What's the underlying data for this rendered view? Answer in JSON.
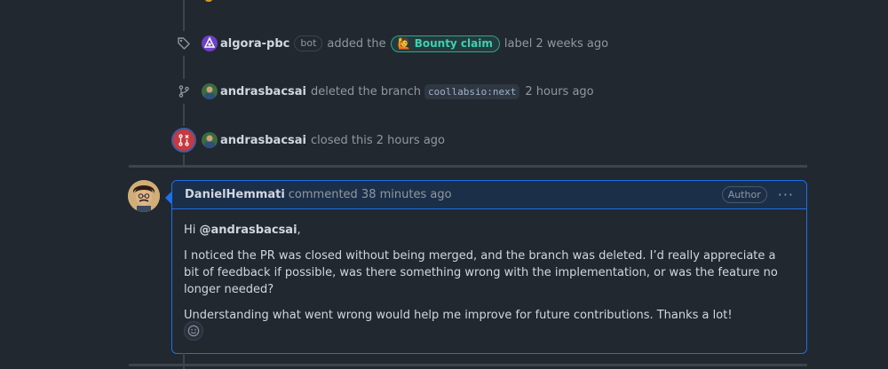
{
  "timeline": {
    "events": [
      {
        "actor": "algora-pbc",
        "bot_tag": "bot",
        "action": "added the",
        "label": "🙋 Bounty claim",
        "trailing": "label",
        "time": "2 weeks ago"
      },
      {
        "actor": "andrasbacsai",
        "action": "deleted the branch",
        "branch": "coollabsio:next",
        "time": "2 hours ago"
      },
      {
        "actor": "andrasbacsai",
        "action": "closed this",
        "time": "2 hours ago"
      }
    ]
  },
  "comment": {
    "author": "DanielHemmati",
    "meta": "commented 38 minutes ago",
    "badge": "Author",
    "menu": "···",
    "greeting_prefix": "Hi ",
    "mention": "@andrasbacsai",
    "greeting_suffix": ",",
    "paragraph1": "I noticed the PR was closed without being merged, and the branch was deleted. I’d really appreciate a bit of feedback if possible, was there something wrong with the implementation, or was the feature no longer needed?",
    "paragraph2": "Understanding what went wrong would help me improve for future contributions. Thanks a lot!"
  },
  "colors": {
    "background": "#212830",
    "comment_border": "#1f6feb",
    "comment_header": "#1c2f48",
    "closed_badge": "#c63a3f",
    "label_teal": "#3fd0b1"
  },
  "icons": [
    "tag-icon",
    "git-branch-icon",
    "pr-closed-icon",
    "smiley-icon",
    "kebab-icon"
  ]
}
